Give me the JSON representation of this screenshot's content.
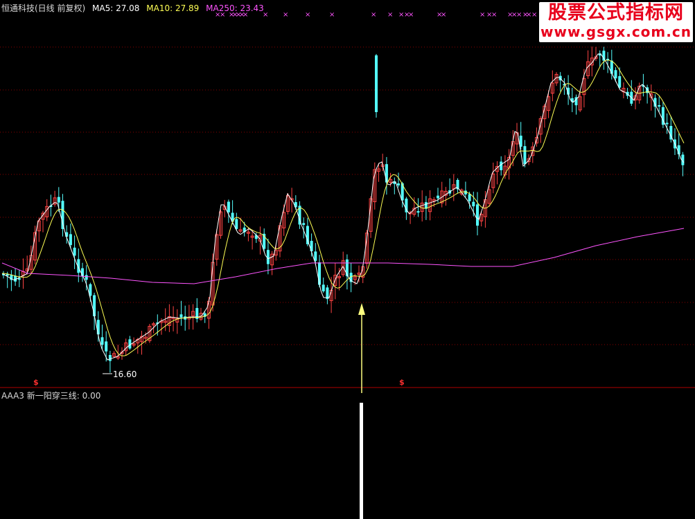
{
  "header": {
    "title": "恒通科技(日线 前复权)",
    "ma5": "MA5: 27.08",
    "ma10": "MA10: 27.89",
    "ma250": "MA250: 23.43"
  },
  "colors": {
    "up": "#ff4444",
    "down": "#54ffff",
    "ma5": "#ffffff",
    "ma10": "#ffff55",
    "ma250": "#ff55ff",
    "grid": "#8b0000",
    "arrow": "#ffff80",
    "text": "#d8d8d8"
  },
  "annotations": {
    "low_label": "16.60",
    "s_marker": "$",
    "x_marker": "×"
  },
  "indicator": {
    "name": "AAA3",
    "label": "新一阳穿三线: 0.00"
  },
  "watermark": {
    "line1": "股票公式指标网",
    "line2": "www.gsgx.com.cn"
  }
}
